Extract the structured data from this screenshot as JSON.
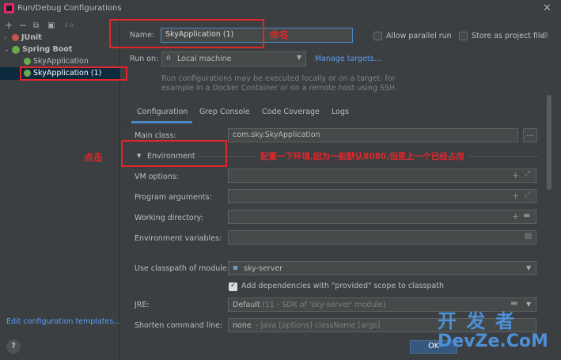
{
  "window": {
    "title": "Run/Debug Configurations",
    "close": "✕"
  },
  "toolbar": {
    "add": "+",
    "remove": "−",
    "copy": "⧉",
    "folder": "▣",
    "sort": "↓a"
  },
  "tree": {
    "junit": "JUnit",
    "spring_boot": "Spring Boot",
    "sky_app": "SkyApplication",
    "sky_app_1": "SkyApplication (1)",
    "edit_templates": "Edit configuration templates..."
  },
  "header": {
    "name_label": "Name:",
    "name_value": "SkyApplication (1)",
    "parallel_label": "Allow parallel run",
    "store_label": "Store as project file",
    "run_on_label": "Run on:",
    "run_on_value": "Local machine",
    "manage_targets": "Manage targets...",
    "hint_line1": "Run configurations may be executed locally or on a target: for",
    "hint_line2": "example in a Docker Container or on a remote host using SSH."
  },
  "tabs": [
    "Configuration",
    "Grep Console",
    "Code Coverage",
    "Logs"
  ],
  "form": {
    "main_class_label": "Main class:",
    "main_class_value": "com.sky.SkyApplication",
    "environment_label": "Environment",
    "vm_options_label": "VM options:",
    "program_args_label": "Program arguments:",
    "working_dir_label": "Working directory:",
    "env_vars_label": "Environment variables:",
    "classpath_label": "Use classpath of module:",
    "classpath_value": "sky-server",
    "add_deps_label": "Add dependencies with \"provided\" scope to classpath",
    "jre_label": "JRE:",
    "jre_value": "Default",
    "jre_hint": "(11 - SDK of 'sky-server' module)",
    "shorten_label": "Shorten command line:",
    "shorten_value": "none",
    "shorten_hint": "- java [options] className [args]",
    "ellipsis": "..."
  },
  "annotations": {
    "rename": "命名",
    "click": "点击",
    "env_note": "配置一下环境,因为一般默认8080,但是上一个已经占用"
  },
  "buttons": {
    "ok": "OK"
  },
  "help": "?",
  "watermark": {
    "line1": "开 发 者",
    "line2": "DevZe.CoM"
  },
  "colors": {
    "annotation_red": "#e3262a",
    "accent_blue": "#4a88c7",
    "link_blue": "#589df6"
  }
}
